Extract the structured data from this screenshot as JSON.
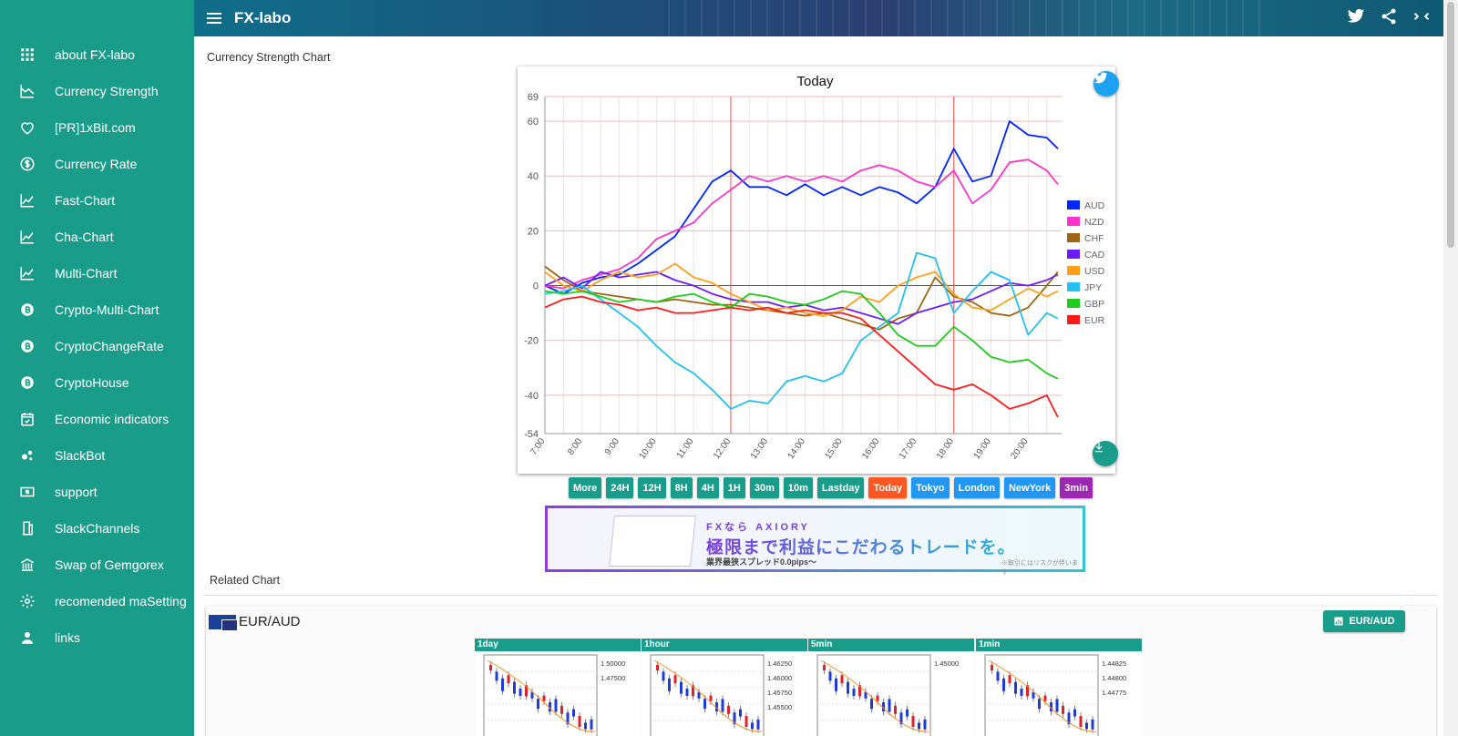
{
  "app": {
    "title": "FX-labo"
  },
  "sidebar": {
    "items": [
      {
        "label": "about FX-labo",
        "icon": "apps-icon"
      },
      {
        "label": "Currency Strength",
        "icon": "chart-icon"
      },
      {
        "label": "[PR]1xBit.com",
        "icon": "heart-icon"
      },
      {
        "label": "Currency Rate",
        "icon": "dollar-coin-icon"
      },
      {
        "label": "Fast-Chart",
        "icon": "line-chart-icon"
      },
      {
        "label": "Cha-Chart",
        "icon": "line-chart-icon"
      },
      {
        "label": "Multi-Chart",
        "icon": "line-chart-icon"
      },
      {
        "label": "Crypto-Multi-Chart",
        "icon": "bitcoin-icon"
      },
      {
        "label": "CryptoChangeRate",
        "icon": "bitcoin-icon"
      },
      {
        "label": "CryptoHouse",
        "icon": "bitcoin-icon"
      },
      {
        "label": "Economic indicators",
        "icon": "calendar-icon"
      },
      {
        "label": "SlackBot",
        "icon": "bubbles-icon"
      },
      {
        "label": "support",
        "icon": "money-icon"
      },
      {
        "label": "SlackChannels",
        "icon": "door-icon"
      },
      {
        "label": "Swap of Gemgorex",
        "icon": "bank-icon"
      },
      {
        "label": "recomended maSetting",
        "icon": "gear-icon"
      },
      {
        "label": "links",
        "icon": "person-icon"
      }
    ]
  },
  "main": {
    "section_title": "Currency Strength Chart",
    "related_title": "Related Chart"
  },
  "chart_data": {
    "type": "line",
    "title": "Today",
    "x_ticks": [
      "7:00",
      "8:00",
      "9:00",
      "10:00",
      "11:00",
      "12:00",
      "13:00",
      "14:00",
      "15:00",
      "16:00",
      "17:00",
      "18:00",
      "19:00",
      "20:00"
    ],
    "ylim": [
      -54,
      69
    ],
    "y_ticks": [
      69,
      60,
      40,
      20,
      0,
      -20,
      -40,
      -54
    ],
    "vertical_markers": [
      "12:00",
      "18:00"
    ],
    "grid": true,
    "legend_position": "right",
    "series": [
      {
        "name": "AUD",
        "color": "#0026ff",
        "points": [
          [
            7,
            0
          ],
          [
            7.5,
            -3
          ],
          [
            8,
            1
          ],
          [
            8.5,
            3
          ],
          [
            9,
            4
          ],
          [
            9.5,
            8
          ],
          [
            10,
            13
          ],
          [
            10.5,
            18
          ],
          [
            11,
            28
          ],
          [
            11.5,
            38
          ],
          [
            12,
            42
          ],
          [
            12.5,
            36
          ],
          [
            13,
            36
          ],
          [
            13.5,
            33
          ],
          [
            14,
            37
          ],
          [
            14.5,
            33
          ],
          [
            15,
            36
          ],
          [
            15.5,
            33
          ],
          [
            16,
            36
          ],
          [
            16.5,
            34
          ],
          [
            17,
            30
          ],
          [
            17.5,
            36
          ],
          [
            18,
            50
          ],
          [
            18.5,
            38
          ],
          [
            19,
            40
          ],
          [
            19.5,
            60
          ],
          [
            20,
            55
          ],
          [
            20.5,
            54
          ],
          [
            20.8,
            50
          ]
        ]
      },
      {
        "name": "NZD",
        "color": "#ff33cc",
        "points": [
          [
            7,
            0
          ],
          [
            7.5,
            -1
          ],
          [
            8,
            2
          ],
          [
            8.5,
            4
          ],
          [
            9,
            6
          ],
          [
            9.5,
            10
          ],
          [
            10,
            17
          ],
          [
            10.5,
            20
          ],
          [
            11,
            23
          ],
          [
            11.5,
            30
          ],
          [
            12,
            35
          ],
          [
            12.5,
            40
          ],
          [
            13,
            38
          ],
          [
            13.5,
            40
          ],
          [
            14,
            38
          ],
          [
            14.5,
            40
          ],
          [
            15,
            38
          ],
          [
            15.5,
            42
          ],
          [
            16,
            44
          ],
          [
            16.5,
            42
          ],
          [
            17,
            38
          ],
          [
            17.5,
            36
          ],
          [
            18,
            42
          ],
          [
            18.5,
            30
          ],
          [
            19,
            35
          ],
          [
            19.5,
            45
          ],
          [
            20,
            46
          ],
          [
            20.5,
            42
          ],
          [
            20.8,
            37
          ]
        ]
      },
      {
        "name": "CHF",
        "color": "#9c6413",
        "points": [
          [
            7,
            7
          ],
          [
            7.5,
            2
          ],
          [
            8,
            -2
          ],
          [
            8.5,
            -3
          ],
          [
            9,
            -4
          ],
          [
            9.5,
            -5
          ],
          [
            10,
            -6
          ],
          [
            10.5,
            -5
          ],
          [
            11,
            -6
          ],
          [
            11.5,
            -7
          ],
          [
            12,
            -7
          ],
          [
            12.5,
            -8
          ],
          [
            13,
            -9
          ],
          [
            13.5,
            -10
          ],
          [
            14,
            -11
          ],
          [
            14.5,
            -10
          ],
          [
            15,
            -12
          ],
          [
            15.5,
            -14
          ],
          [
            16,
            -16
          ],
          [
            16.5,
            -12
          ],
          [
            17,
            -10
          ],
          [
            17.5,
            3
          ],
          [
            18,
            -4
          ],
          [
            18.5,
            -6
          ],
          [
            19,
            -10
          ],
          [
            19.5,
            -11
          ],
          [
            20,
            -8
          ],
          [
            20.5,
            0
          ],
          [
            20.8,
            5
          ]
        ]
      },
      {
        "name": "CAD",
        "color": "#6b1cff",
        "points": [
          [
            7,
            0
          ],
          [
            7.5,
            3
          ],
          [
            8,
            -1
          ],
          [
            8.5,
            5
          ],
          [
            9,
            3
          ],
          [
            9.5,
            4
          ],
          [
            10,
            5
          ],
          [
            10.5,
            2
          ],
          [
            11,
            0
          ],
          [
            11.5,
            -3
          ],
          [
            12,
            -5
          ],
          [
            12.5,
            -6
          ],
          [
            13,
            -6
          ],
          [
            13.5,
            -8
          ],
          [
            14,
            -7
          ],
          [
            14.5,
            -9
          ],
          [
            15,
            -8
          ],
          [
            15.5,
            -10
          ],
          [
            16,
            -12
          ],
          [
            16.5,
            -14
          ],
          [
            17,
            -10
          ],
          [
            17.5,
            -8
          ],
          [
            18,
            -6
          ],
          [
            18.5,
            -5
          ],
          [
            19,
            -2
          ],
          [
            19.5,
            1
          ],
          [
            20,
            0
          ],
          [
            20.5,
            2
          ],
          [
            20.8,
            4
          ]
        ]
      },
      {
        "name": "USD",
        "color": "#ff9f1a",
        "points": [
          [
            7,
            5
          ],
          [
            7.5,
            0
          ],
          [
            8,
            -2
          ],
          [
            8.5,
            2
          ],
          [
            9,
            5
          ],
          [
            9.5,
            3
          ],
          [
            10,
            4
          ],
          [
            10.5,
            8
          ],
          [
            11,
            3
          ],
          [
            11.5,
            1
          ],
          [
            12,
            -3
          ],
          [
            12.5,
            -6
          ],
          [
            13,
            -9
          ],
          [
            13.5,
            -8
          ],
          [
            14,
            -10
          ],
          [
            14.5,
            -11
          ],
          [
            15,
            -9
          ],
          [
            15.5,
            -4
          ],
          [
            16,
            -6
          ],
          [
            16.5,
            0
          ],
          [
            17,
            3
          ],
          [
            17.5,
            5
          ],
          [
            18,
            -3
          ],
          [
            18.5,
            -8
          ],
          [
            19,
            -9
          ],
          [
            19.5,
            -5
          ],
          [
            20,
            -1
          ],
          [
            20.5,
            -4
          ],
          [
            20.8,
            -2
          ]
        ]
      },
      {
        "name": "JPY",
        "color": "#23c0f2",
        "points": [
          [
            7,
            -3
          ],
          [
            7.5,
            -2
          ],
          [
            8,
            0
          ],
          [
            8.5,
            -5
          ],
          [
            9,
            -10
          ],
          [
            9.5,
            -15
          ],
          [
            10,
            -22
          ],
          [
            10.5,
            -28
          ],
          [
            11,
            -32
          ],
          [
            11.5,
            -38
          ],
          [
            12,
            -45
          ],
          [
            12.5,
            -42
          ],
          [
            13,
            -43
          ],
          [
            13.5,
            -35
          ],
          [
            14,
            -33
          ],
          [
            14.5,
            -35
          ],
          [
            15,
            -32
          ],
          [
            15.5,
            -20
          ],
          [
            16,
            -15
          ],
          [
            16.5,
            -10
          ],
          [
            17,
            12
          ],
          [
            17.5,
            10
          ],
          [
            18,
            -10
          ],
          [
            18.5,
            -2
          ],
          [
            19,
            5
          ],
          [
            19.5,
            2
          ],
          [
            20,
            -18
          ],
          [
            20.5,
            -10
          ],
          [
            20.8,
            -12
          ]
        ]
      },
      {
        "name": "GBP",
        "color": "#1ecc1e",
        "points": [
          [
            7,
            -2
          ],
          [
            7.5,
            -3
          ],
          [
            8,
            -2
          ],
          [
            8.5,
            -4
          ],
          [
            9,
            -6
          ],
          [
            9.5,
            -5
          ],
          [
            10,
            -6
          ],
          [
            10.5,
            -4
          ],
          [
            11,
            -3
          ],
          [
            11.5,
            -6
          ],
          [
            12,
            -8
          ],
          [
            12.5,
            -3
          ],
          [
            13,
            -4
          ],
          [
            13.5,
            -6
          ],
          [
            14,
            -7
          ],
          [
            14.5,
            -5
          ],
          [
            15,
            -2
          ],
          [
            15.5,
            -3
          ],
          [
            16,
            -10
          ],
          [
            16.5,
            -18
          ],
          [
            17,
            -22
          ],
          [
            17.5,
            -22
          ],
          [
            18,
            -15
          ],
          [
            18.5,
            -20
          ],
          [
            19,
            -26
          ],
          [
            19.5,
            -28
          ],
          [
            20,
            -27
          ],
          [
            20.5,
            -32
          ],
          [
            20.8,
            -34
          ]
        ]
      },
      {
        "name": "EUR",
        "color": "#ff1a1a",
        "points": [
          [
            7,
            -8
          ],
          [
            7.5,
            -5
          ],
          [
            8,
            -4
          ],
          [
            8.5,
            -6
          ],
          [
            9,
            -7
          ],
          [
            9.5,
            -9
          ],
          [
            10,
            -8
          ],
          [
            10.5,
            -10
          ],
          [
            11,
            -10
          ],
          [
            11.5,
            -9
          ],
          [
            12,
            -8
          ],
          [
            12.5,
            -9
          ],
          [
            13,
            -8
          ],
          [
            13.5,
            -10
          ],
          [
            14,
            -9
          ],
          [
            14.5,
            -10
          ],
          [
            15,
            -10
          ],
          [
            15.5,
            -12
          ],
          [
            16,
            -18
          ],
          [
            16.5,
            -24
          ],
          [
            17,
            -30
          ],
          [
            17.5,
            -36
          ],
          [
            18,
            -38
          ],
          [
            18.5,
            -36
          ],
          [
            19,
            -40
          ],
          [
            19.5,
            -45
          ],
          [
            20,
            -43
          ],
          [
            20.5,
            -40
          ],
          [
            20.8,
            -48
          ]
        ]
      }
    ]
  },
  "range_buttons": [
    {
      "label": "More",
      "color": "#1a9c8a"
    },
    {
      "label": "24H",
      "color": "#1a9c8a"
    },
    {
      "label": "12H",
      "color": "#1a9c8a"
    },
    {
      "label": "8H",
      "color": "#1a9c8a"
    },
    {
      "label": "4H",
      "color": "#1a9c8a"
    },
    {
      "label": "1H",
      "color": "#1a9c8a"
    },
    {
      "label": "30m",
      "color": "#1a9c8a"
    },
    {
      "label": "10m",
      "color": "#1a9c8a"
    },
    {
      "label": "Lastday",
      "color": "#1a9c8a"
    },
    {
      "label": "Today",
      "color": "#ff5722"
    },
    {
      "label": "Tokyo",
      "color": "#2196f3"
    },
    {
      "label": "London",
      "color": "#2196f3"
    },
    {
      "label": "NewYork",
      "color": "#2196f3"
    },
    {
      "label": "3min",
      "color": "#9c27b0"
    }
  ],
  "banner": {
    "logo": "FXなら AXIORY",
    "headline": "極限まで利益にこだわるトレードを。",
    "sub": "業界最狭スプレッド0.0pips〜",
    "note": "※取引にはリスクが伴います"
  },
  "related": {
    "pair": "EUR/AUD",
    "button_label": "EUR/AUD",
    "mini_charts": [
      {
        "label": "1day",
        "ticks": [
          "1.50000",
          "1.47500"
        ]
      },
      {
        "label": "1hour",
        "ticks": [
          "1.46250",
          "1.46000",
          "1.45750",
          "1.45500"
        ]
      },
      {
        "label": "5min",
        "ticks": [
          "1.45000"
        ]
      },
      {
        "label": "1min",
        "ticks": [
          "1.44825",
          "1.44800",
          "1.44775"
        ]
      }
    ]
  }
}
